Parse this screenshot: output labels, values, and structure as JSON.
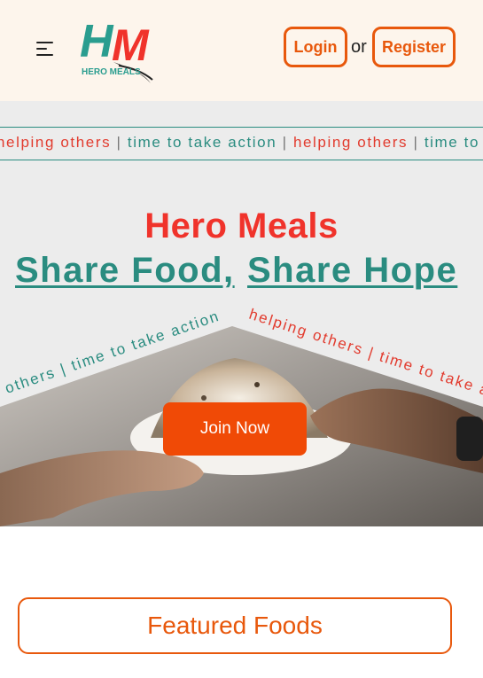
{
  "header": {
    "logo_text": "HERO MEALS",
    "logo_monogram": "HM",
    "login_label": "Login",
    "or_label": "or",
    "register_label": "Register"
  },
  "marquee": {
    "phrase_a": "helping others",
    "separator": "|",
    "phrase_b": "time to take action"
  },
  "hero": {
    "title": "Hero Meals",
    "tagline_left": "Share Food,",
    "tagline_right": "Share Hope",
    "join_label": "Join Now",
    "curve_left": "others | time to take action",
    "curve_right": "helping others | time to take a"
  },
  "featured": {
    "heading": "Featured Foods"
  },
  "colors": {
    "accent_orange": "#e8580c",
    "brand_red": "#f0332b",
    "brand_teal": "#2a8c80",
    "header_bg": "#fdf5ec"
  },
  "icons": {
    "menu": "menu-icon",
    "logo": "hero-meals-logo"
  }
}
